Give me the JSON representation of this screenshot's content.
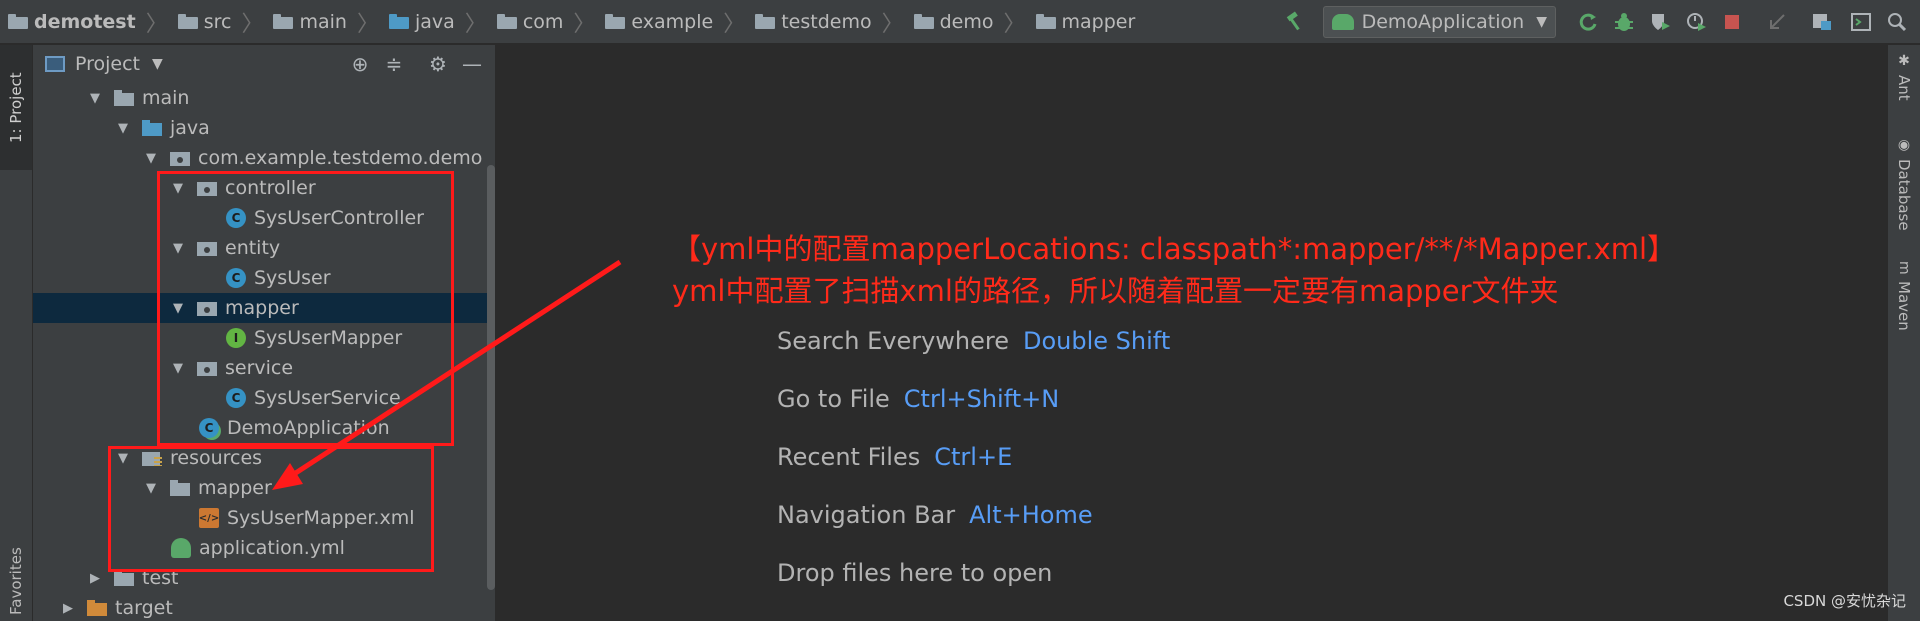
{
  "breadcrumbs": [
    {
      "label": "demotest",
      "kind": "root"
    },
    {
      "label": "src",
      "kind": "folder"
    },
    {
      "label": "main",
      "kind": "folder"
    },
    {
      "label": "java",
      "kind": "blue"
    },
    {
      "label": "com",
      "kind": "pkg"
    },
    {
      "label": "example",
      "kind": "pkg"
    },
    {
      "label": "testdemo",
      "kind": "pkg"
    },
    {
      "label": "demo",
      "kind": "pkg"
    },
    {
      "label": "mapper",
      "kind": "pkg"
    }
  ],
  "toolbar": {
    "run_config": "DemoApplication",
    "icons": [
      "build-hammer-icon",
      "rerun-icon",
      "debug-bug-icon",
      "coverage-icon",
      "profile-icon",
      "stop-icon",
      "vcs-update-icon",
      "project-structure-icon",
      "terminal-icon"
    ]
  },
  "left_strip": {
    "project_tab": "1: Project",
    "favorites_tab": "Favorites"
  },
  "right_strip": {
    "ant": "Ant",
    "database": "Database",
    "maven": "Maven"
  },
  "panel": {
    "title": "Project"
  },
  "tree": [
    {
      "label": "main",
      "icon": "folder",
      "expanded": true
    },
    {
      "label": "java",
      "icon": "src",
      "expanded": true
    },
    {
      "label": "com.example.testdemo.demo",
      "icon": "pkg",
      "expanded": true
    },
    {
      "label": "controller",
      "icon": "pkg",
      "expanded": true
    },
    {
      "label": "SysUserController",
      "icon": "class"
    },
    {
      "label": "entity",
      "icon": "pkg",
      "expanded": true
    },
    {
      "label": "SysUser",
      "icon": "class"
    },
    {
      "label": "mapper",
      "icon": "pkg",
      "expanded": true,
      "selected": true
    },
    {
      "label": "SysUserMapper",
      "icon": "interface"
    },
    {
      "label": "service",
      "icon": "pkg",
      "expanded": true
    },
    {
      "label": "SysUserService",
      "icon": "class"
    },
    {
      "label": "DemoApplication",
      "icon": "app"
    },
    {
      "label": "resources",
      "icon": "res",
      "expanded": true
    },
    {
      "label": "mapper",
      "icon": "folder",
      "expanded": true
    },
    {
      "label": "SysUserMapper.xml",
      "icon": "xml"
    },
    {
      "label": "application.yml",
      "icon": "yml"
    },
    {
      "label": "test",
      "icon": "folder",
      "expanded": false
    },
    {
      "label": "target",
      "icon": "target",
      "expanded": false
    }
  ],
  "hints": [
    {
      "action": "Search Everywhere",
      "key": "Double Shift"
    },
    {
      "action": "Go to File",
      "key": "Ctrl+Shift+N"
    },
    {
      "action": "Recent Files",
      "key": "Ctrl+E"
    },
    {
      "action": "Navigation Bar",
      "key": "Alt+Home"
    },
    {
      "action": "Drop files here to open",
      "key": ""
    }
  ],
  "annotation": {
    "line1": "【yml中的配置mapperLocations: classpath*:mapper/**/*Mapper.xml】",
    "line2": "yml中配置了扫描xml的路径，所以随着配置一定要有mapper文件夹",
    "color": "#ff2a1a"
  },
  "watermark": "CSDN @安忧杂记",
  "colors": {
    "accent_link": "#589df6",
    "selection": "#0d293e",
    "highlight_box": "#ff1a1a"
  }
}
